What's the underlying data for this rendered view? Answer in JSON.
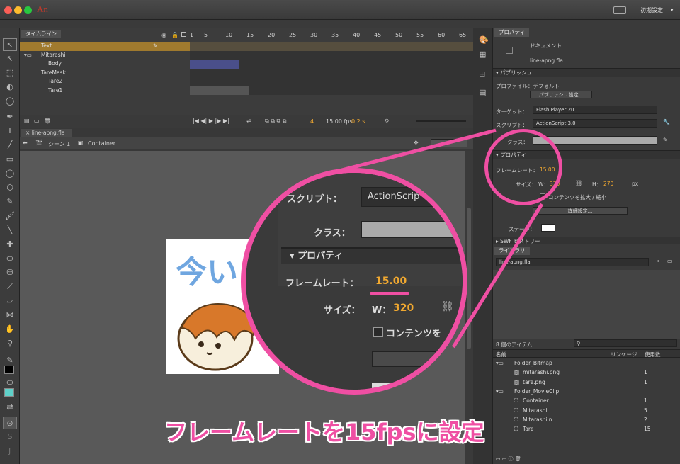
{
  "app": {
    "name": "An",
    "workspace": "初期設定"
  },
  "timeline": {
    "tab": "タイムライン",
    "ruler": [
      "1",
      "5",
      "10",
      "15",
      "20",
      "25",
      "30",
      "35",
      "40",
      "45",
      "50",
      "55",
      "60",
      "65"
    ],
    "layers": [
      {
        "name": "Text",
        "selected": true
      },
      {
        "name": "Mitarashi"
      },
      {
        "name": "Body"
      },
      {
        "name": "TareMask"
      },
      {
        "name": "Tare2"
      },
      {
        "name": "Tare1"
      }
    ],
    "current_frame": "4",
    "fps": "15.00 fps",
    "time": "0.2 s"
  },
  "document": {
    "tab": "line-apng.fla",
    "scene": "シーン 1",
    "symbol": "Container"
  },
  "properties": {
    "tab": "プロパティ",
    "doc_label": "ドキュメント",
    "file": "line-apng.fla",
    "publish_section": "パブリッシュ",
    "profile": "プロファイル：デフォルト",
    "publish_settings": "パブリッシュ設定...",
    "target_label": "ターゲット：",
    "target": "Flash Player 20",
    "script_label": "スクリプト：",
    "script": "ActionScript 3.0",
    "class_label": "クラス：",
    "props_section": "プロパティ",
    "framerate_label": "フレームレート：",
    "framerate": "15.00",
    "size_label": "サイズ：",
    "w_label": "W：",
    "w": "320",
    "h_label": "H：",
    "h": "270",
    "unit": "px",
    "scale_content": "コンテンツを拡大 / 縮小",
    "advanced": "詳細設定...",
    "stage_label": "ステージ：",
    "swf_section": "SWF ヒストリー",
    "accent": "#f0a830"
  },
  "library": {
    "tab": "ライブラリ",
    "file": "line-apng.fla",
    "count": "8 個のアイテム",
    "col_name": "名前",
    "col_linkage": "リンケージ",
    "col_usage": "使用数",
    "items": [
      {
        "name": "Folder_Bitmap",
        "use": "",
        "indent": 0
      },
      {
        "name": "mitarashi.png",
        "use": "1",
        "indent": 1
      },
      {
        "name": "tare.png",
        "use": "1",
        "indent": 1
      },
      {
        "name": "Folder_MovieClip",
        "use": "",
        "indent": 0
      },
      {
        "name": "Container",
        "use": "1",
        "indent": 1
      },
      {
        "name": "Mitarashi",
        "use": "5",
        "indent": 1
      },
      {
        "name": "MitarashiIn",
        "use": "2",
        "indent": 1
      },
      {
        "name": "Tare",
        "use": "15",
        "indent": 1
      }
    ]
  },
  "zoom": {
    "script_label": "スクリプト：",
    "script": "ActionScrip",
    "class_label": "クラス：",
    "props_section": "プロパティ",
    "framerate_label": "フレームレート：",
    "framerate": "15.00",
    "size_label": "サイズ：",
    "w_label": "W：",
    "w": "320",
    "scale_content": "コンテンツを"
  },
  "stage_text": "今い",
  "caption": "フレームレートを15fpsに設定",
  "highlight_color": "#ef4fa3"
}
